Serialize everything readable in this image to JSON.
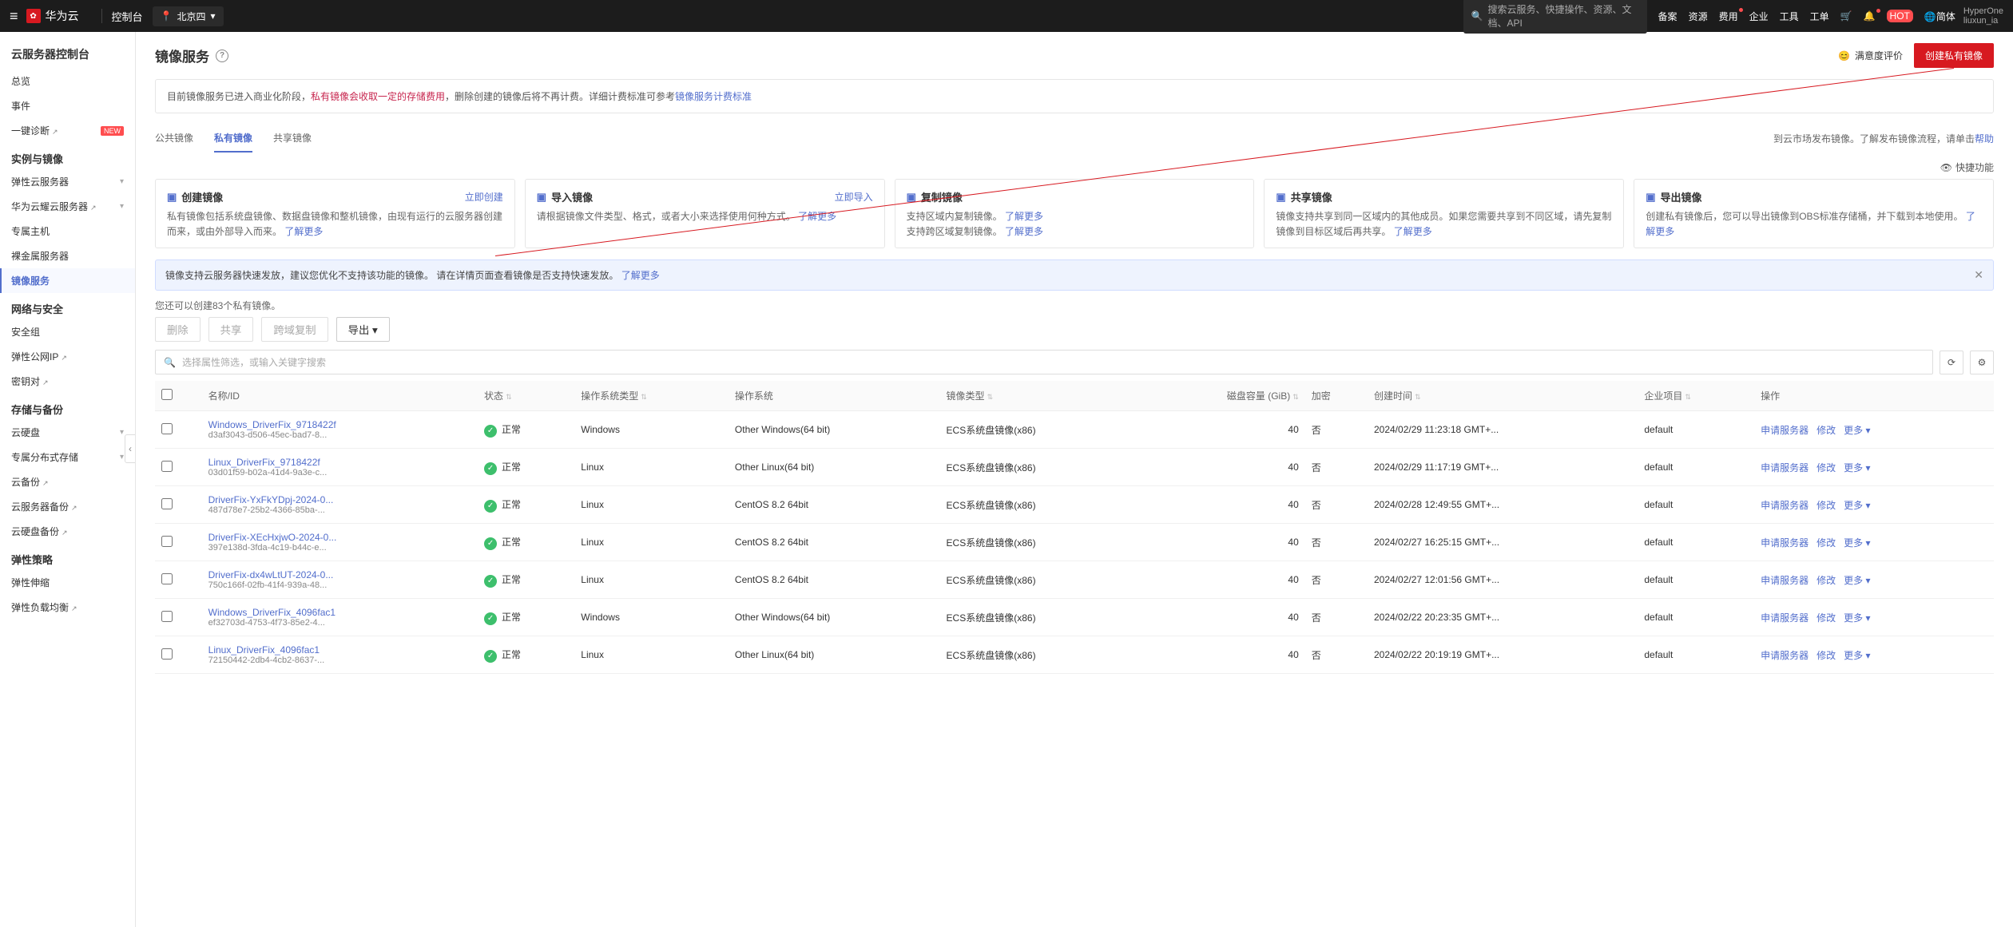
{
  "topbar": {
    "brand": "华为云",
    "console": "控制台",
    "region": "北京四",
    "search_ph": "搜索云服务、快捷操作、资源、文档、API",
    "links": [
      "备案",
      "资源",
      "费用",
      "企业",
      "工具",
      "工单"
    ],
    "lang": "简体",
    "user1": "HyperOne",
    "user2": "liuxun_ia"
  },
  "sidebar": {
    "title": "云服务器控制台",
    "items": [
      {
        "label": "总览",
        "type": "item"
      },
      {
        "label": "事件",
        "type": "item"
      },
      {
        "label": "一键诊断",
        "type": "item",
        "badge": "NEW",
        "ext": true
      },
      {
        "label": "实例与镜像",
        "type": "cat"
      },
      {
        "label": "弹性云服务器",
        "type": "item",
        "caret": true
      },
      {
        "label": "华为云耀云服务器",
        "type": "item",
        "caret": true,
        "ext": true
      },
      {
        "label": "专属主机",
        "type": "item"
      },
      {
        "label": "裸金属服务器",
        "type": "item"
      },
      {
        "label": "镜像服务",
        "type": "item",
        "active": true
      },
      {
        "label": "网络与安全",
        "type": "cat"
      },
      {
        "label": "安全组",
        "type": "item"
      },
      {
        "label": "弹性公网IP",
        "type": "item",
        "ext": true
      },
      {
        "label": "密钥对",
        "type": "item",
        "ext": true
      },
      {
        "label": "存储与备份",
        "type": "cat"
      },
      {
        "label": "云硬盘",
        "type": "item",
        "caret": true
      },
      {
        "label": "专属分布式存储",
        "type": "item",
        "caret": true
      },
      {
        "label": "云备份",
        "type": "item",
        "ext": true
      },
      {
        "label": "云服务器备份",
        "type": "item",
        "ext": true
      },
      {
        "label": "云硬盘备份",
        "type": "item",
        "ext": true
      },
      {
        "label": "弹性策略",
        "type": "cat"
      },
      {
        "label": "弹性伸缩",
        "type": "item"
      },
      {
        "label": "弹性负载均衡",
        "type": "item",
        "ext": true
      }
    ]
  },
  "page": {
    "title": "镜像服务",
    "rating": "满意度评价",
    "create_btn": "创建私有镜像"
  },
  "notice": {
    "pre": "目前镜像服务已进入商业化阶段，",
    "warn": "私有镜像会收取一定的存储费用",
    "post": "，删除创建的镜像后将不再计费。详细计费标准可参考",
    "link": "镜像服务计费标准"
  },
  "tabs": {
    "items": [
      "公共镜像",
      "私有镜像",
      "共享镜像"
    ],
    "active": 1,
    "tip_pre": "到云市场发布镜像。了解发布镜像流程，请单击",
    "tip_link": "帮助"
  },
  "quick_func": "快捷功能",
  "cards": [
    {
      "title": "创建镜像",
      "action": "立即创建",
      "desc": "私有镜像包括系统盘镜像、数据盘镜像和整机镜像，由现有运行的云服务器创建而来，或由外部导入而来。",
      "more": "了解更多"
    },
    {
      "title": "导入镜像",
      "action": "立即导入",
      "desc": "请根据镜像文件类型、格式，或者大小来选择使用何种方式。",
      "more": "了解更多"
    },
    {
      "title": "复制镜像",
      "action": "",
      "desc": "支持区域内复制镜像。",
      "more": "了解更多",
      "desc2": "支持跨区域复制镜像。",
      "more2": "了解更多"
    },
    {
      "title": "共享镜像",
      "action": "",
      "desc": "镜像支持共享到同一区域内的其他成员。如果您需要共享到不同区域，请先复制镜像到目标区域后再共享。",
      "more": "了解更多"
    },
    {
      "title": "导出镜像",
      "action": "",
      "desc": "创建私有镜像后，您可以导出镜像到OBS标准存储桶，并下载到本地使用。",
      "more": "了解更多"
    }
  ],
  "banner": {
    "text": "镜像支持云服务器快速发放，建议您优化不支持该功能的镜像。 请在详情页面查看镜像是否支持快速发放。",
    "more": "了解更多"
  },
  "count_tip": "您还可以创建83个私有镜像。",
  "actions": {
    "delete": "删除",
    "share": "共享",
    "cross": "跨域复制",
    "export": "导出"
  },
  "search_ph": "选择属性筛选，或输入关键字搜索",
  "columns": [
    "名称/ID",
    "状态",
    "操作系统类型",
    "操作系统",
    "镜像类型",
    "磁盘容量 (GiB)",
    "加密",
    "创建时间",
    "企业项目",
    "操作"
  ],
  "status_ok": "正常",
  "ops": {
    "apply": "申请服务器",
    "edit": "修改",
    "more": "更多"
  },
  "rows": [
    {
      "name": "Windows_DriverFix_9718422f",
      "id": "d3af3043-d506-45ec-bad7-8...",
      "ostype": "Windows",
      "os": "Other Windows(64 bit)",
      "imgtype": "ECS系统盘镜像(x86)",
      "cap": 40,
      "enc": "否",
      "time": "2024/02/29 11:23:18 GMT+...",
      "proj": "default"
    },
    {
      "name": "Linux_DriverFix_9718422f",
      "id": "03d01f59-b02a-41d4-9a3e-c...",
      "ostype": "Linux",
      "os": "Other Linux(64 bit)",
      "imgtype": "ECS系统盘镜像(x86)",
      "cap": 40,
      "enc": "否",
      "time": "2024/02/29 11:17:19 GMT+...",
      "proj": "default"
    },
    {
      "name": "DriverFix-YxFkYDpj-2024-0...",
      "id": "487d78e7-25b2-4366-85ba-...",
      "ostype": "Linux",
      "os": "CentOS 8.2 64bit",
      "imgtype": "ECS系统盘镜像(x86)",
      "cap": 40,
      "enc": "否",
      "time": "2024/02/28 12:49:55 GMT+...",
      "proj": "default"
    },
    {
      "name": "DriverFix-XEcHxjwO-2024-0...",
      "id": "397e138d-3fda-4c19-b44c-e...",
      "ostype": "Linux",
      "os": "CentOS 8.2 64bit",
      "imgtype": "ECS系统盘镜像(x86)",
      "cap": 40,
      "enc": "否",
      "time": "2024/02/27 16:25:15 GMT+...",
      "proj": "default"
    },
    {
      "name": "DriverFix-dx4wLtUT-2024-0...",
      "id": "750c166f-02fb-41f4-939a-48...",
      "ostype": "Linux",
      "os": "CentOS 8.2 64bit",
      "imgtype": "ECS系统盘镜像(x86)",
      "cap": 40,
      "enc": "否",
      "time": "2024/02/27 12:01:56 GMT+...",
      "proj": "default"
    },
    {
      "name": "Windows_DriverFix_4096fac1",
      "id": "ef32703d-4753-4f73-85e2-4...",
      "ostype": "Windows",
      "os": "Other Windows(64 bit)",
      "imgtype": "ECS系统盘镜像(x86)",
      "cap": 40,
      "enc": "否",
      "time": "2024/02/22 20:23:35 GMT+...",
      "proj": "default"
    },
    {
      "name": "Linux_DriverFix_4096fac1",
      "id": "72150442-2db4-4cb2-8637-...",
      "ostype": "Linux",
      "os": "Other Linux(64 bit)",
      "imgtype": "ECS系统盘镜像(x86)",
      "cap": 40,
      "enc": "否",
      "time": "2024/02/22 20:19:19 GMT+...",
      "proj": "default"
    }
  ]
}
